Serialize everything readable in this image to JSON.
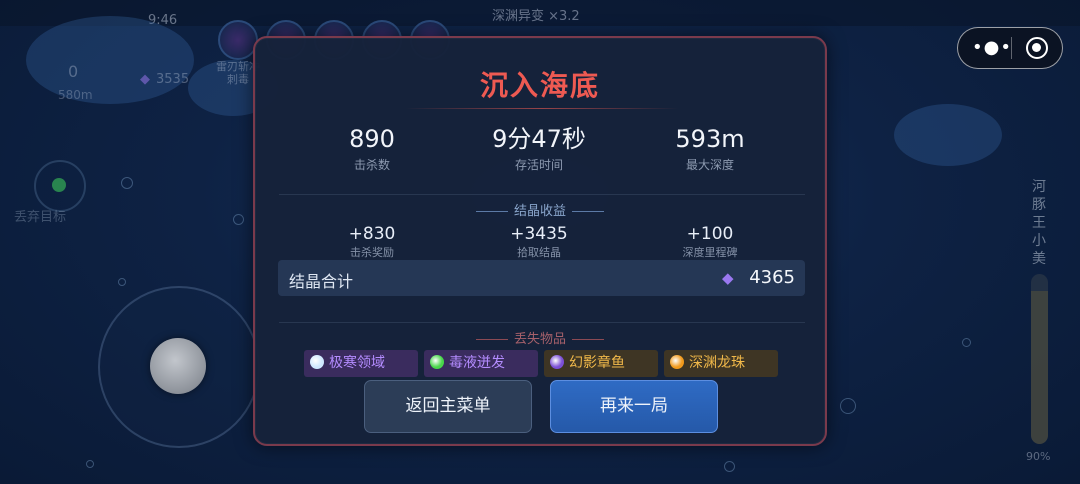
{
  "background_hud": {
    "mode_text": "深渊异变 ×3.2",
    "clock": "9:46",
    "score": "0",
    "depth": "580m",
    "crystals": "3535",
    "skill_text": "雷刃斩冲刺毒",
    "target_label": "丢弃目标",
    "boss_name": "河豚王小美",
    "boss_hp_percent": 90,
    "boss_hp_label": "90%"
  },
  "capsule": {
    "more_glyph": "•●•"
  },
  "result": {
    "title": "沉入海底",
    "stats": [
      {
        "value": "890",
        "label": "击杀数"
      },
      {
        "value": "9分47秒",
        "label": "存活时间"
      },
      {
        "value": "593m",
        "label": "最大深度"
      }
    ],
    "crystal_section_title": "结晶收益",
    "rewards": [
      {
        "value": "+830",
        "label": "击杀奖励"
      },
      {
        "value": "+3435",
        "label": "拾取结晶"
      },
      {
        "value": "+100",
        "label": "深度里程碑"
      }
    ],
    "total_label": "结晶合计",
    "total_value": "4365",
    "lost_section_title": "丢失物品",
    "lost_items": [
      {
        "name": "极寒领域",
        "icon": "ice-orb-icon",
        "color": "#b48cff",
        "bg": "#3a2c5e",
        "dot": "#cfe8ff"
      },
      {
        "name": "毒液迸发",
        "icon": "venom-orb-icon",
        "color": "#b48cff",
        "bg": "#3a2c5e",
        "dot": "#48d64a"
      },
      {
        "name": "幻影章鱼",
        "icon": "octopus-icon",
        "color": "#f1b94a",
        "bg": "#3e3524",
        "dot": "#7b4fd6"
      },
      {
        "name": "深渊龙珠",
        "icon": "dragon-pearl-icon",
        "color": "#f1b94a",
        "bg": "#3e3524",
        "dot": "#f29a1c"
      }
    ],
    "buttons": {
      "menu": "返回主菜单",
      "again": "再来一局"
    }
  },
  "colors": {
    "title": "#ee5a52",
    "panel_border": "#7a3a4c",
    "primary_button": "#2f6bc4",
    "crystal_gem": "#9a78f0"
  }
}
